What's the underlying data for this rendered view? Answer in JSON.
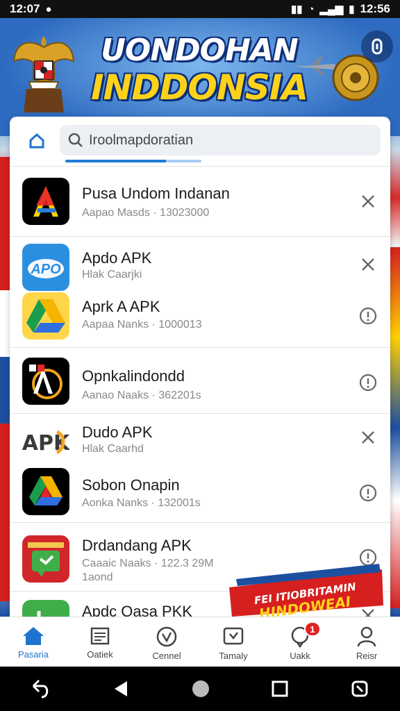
{
  "status_bar": {
    "time": "12:07",
    "battery_time": "12:56"
  },
  "header": {
    "title_line1": "UONDOHAN",
    "title_line2": "INDDONSIA"
  },
  "search": {
    "value": "Iroolmapdoratian"
  },
  "items": [
    {
      "name": "Pusa Undom Indanan",
      "sub": "Aapao Masds · 13023000",
      "action": "close"
    },
    {
      "name": "Apdo APK",
      "sub": "Hlak Caarjki",
      "action": "close"
    },
    {
      "name": "Aprk A APK",
      "sub": "Aapaa Nanks · 1000013",
      "action": "info"
    },
    {
      "name": "Opnkalindondd",
      "sub": "Aanao Naaks · 362201s",
      "action": "info"
    },
    {
      "name": "Dudo APK",
      "sub": "Hlak Caarhd",
      "action": "close"
    },
    {
      "name": "Sobon Onapin",
      "sub": "Aonka Nanks · 132001s",
      "action": "info"
    },
    {
      "name": "Drdandang APK",
      "sub": "Caaaic Naaks · 122.3 29M",
      "sub2": "1aond",
      "action": "info"
    },
    {
      "name": "Apdc Oasa PKK",
      "sub": "",
      "action": "close"
    }
  ],
  "icon_labels": {
    "apk_text": "APK",
    "apdo_text": "APO"
  },
  "promo": {
    "line1": "FEI ITIOBRITAMIN",
    "line2": "HINDOWEAI"
  },
  "bottom_nav": [
    {
      "label": "Pasaria",
      "icon": "home-icon"
    },
    {
      "label": "Oatiek",
      "icon": "news-icon"
    },
    {
      "label": "Cennel",
      "icon": "compass-icon"
    },
    {
      "label": "Tamaly",
      "icon": "gallery-icon"
    },
    {
      "label": "Uakk",
      "icon": "chat-icon",
      "badge": "1"
    },
    {
      "label": "Reisr",
      "icon": "profile-icon"
    }
  ],
  "colors": {
    "accent": "#1f73d0",
    "badge": "#e02424",
    "title_yellow": "#ffd21a"
  }
}
